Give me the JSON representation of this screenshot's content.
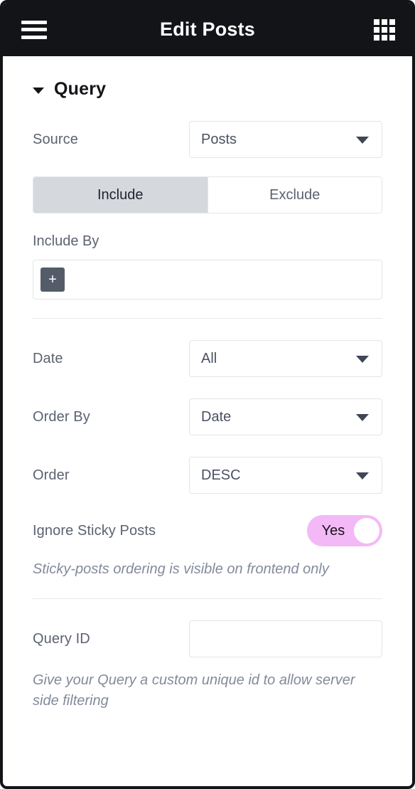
{
  "header": {
    "title": "Edit Posts",
    "menu_icon": "hamburger-menu-icon",
    "apps_icon": "apps-grid-icon"
  },
  "section": {
    "title": "Query",
    "collapse_icon": "caret-down-icon",
    "expanded": true
  },
  "fields": {
    "source": {
      "label": "Source",
      "value": "Posts",
      "options": [
        "Posts"
      ]
    },
    "include_exclude": {
      "include_label": "Include",
      "exclude_label": "Exclude",
      "active": "Include"
    },
    "include_by": {
      "label": "Include By",
      "add_button": "+",
      "value": ""
    },
    "date": {
      "label": "Date",
      "value": "All",
      "options": [
        "All"
      ]
    },
    "order_by": {
      "label": "Order By",
      "value": "Date",
      "options": [
        "Date"
      ]
    },
    "order": {
      "label": "Order",
      "value": "DESC",
      "options": [
        "DESC"
      ]
    },
    "ignore_sticky_posts": {
      "label": "Ignore Sticky Posts",
      "value": "Yes",
      "state": "on",
      "helper": "Sticky-posts ordering is visible on frontend only"
    },
    "query_id": {
      "label": "Query ID",
      "value": "",
      "placeholder": "",
      "addon_icon": "database-icon",
      "helper": "Give your Query a custom unique id to allow server side filtering"
    }
  },
  "colors": {
    "header_bg": "#131417",
    "toggle_on": "#f3b9f7",
    "segment_active": "#d5d8dd",
    "label_text": "#5b6271",
    "helper_text": "#828a9b",
    "border": "#e3e5e9",
    "plus_button": "#555c69"
  }
}
